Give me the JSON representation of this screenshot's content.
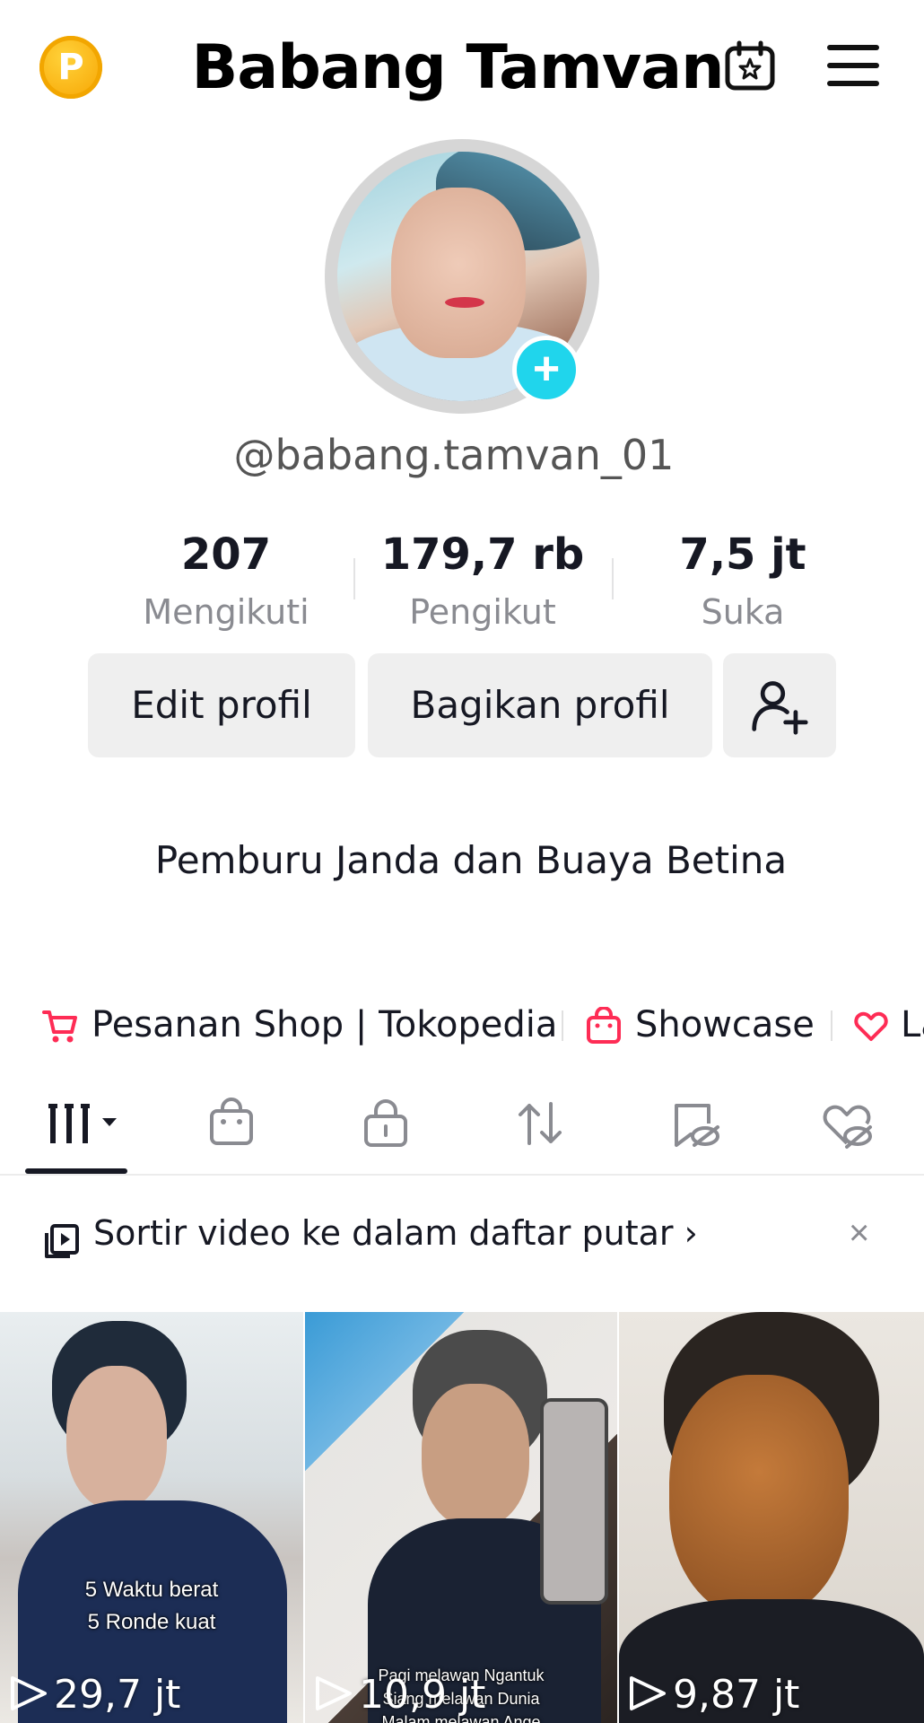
{
  "header": {
    "coin_letter": "P",
    "title": "Babang Tamvan"
  },
  "profile": {
    "username": "@babang.tamvan_01",
    "bio": "Pemburu Janda dan Buaya Betina",
    "stats": [
      {
        "value": "207",
        "label": "Mengikuti"
      },
      {
        "value": "179,7 rb",
        "label": "Pengikut"
      },
      {
        "value": "7,5 jt",
        "label": "Suka"
      }
    ],
    "buttons": {
      "edit": "Edit profil",
      "share": "Bagikan profil"
    }
  },
  "links": {
    "shop": "Pesanan Shop | Tokopedia",
    "showcase": "Showcase",
    "third": "La"
  },
  "tabs": [
    "videos-grid",
    "shop",
    "private",
    "repost",
    "favorites",
    "liked"
  ],
  "banner": {
    "text": "Sortir video ke dalam daftar putar",
    "arrow": "›",
    "close": "×"
  },
  "videos": [
    {
      "caption_lines": [
        "5 Waktu berat",
        "5 Ronde kuat"
      ],
      "views": "29,7 jt"
    },
    {
      "caption_lines": [
        "Pagi melawan Ngantuk",
        "Siang melawan Dunia",
        "Malam melawan Ange"
      ],
      "views": "10,9 jt"
    },
    {
      "caption_lines": [],
      "views": "9,87 jt"
    }
  ],
  "colors": {
    "accent_cyan": "#20d5ec",
    "shop_red": "#fe2c55",
    "coin_orange": "#f7a300"
  }
}
